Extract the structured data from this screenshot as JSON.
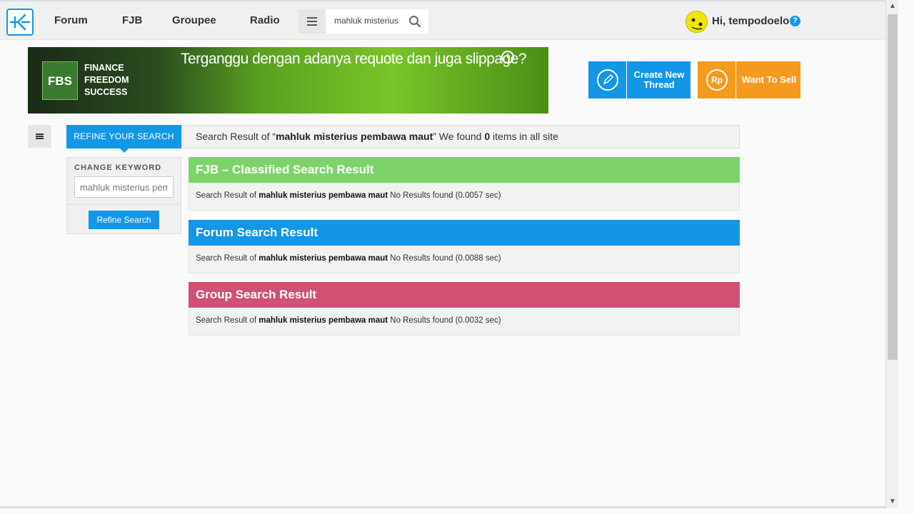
{
  "topbar": {
    "nav": [
      "Forum",
      "FJB",
      "Groupee",
      "Radio"
    ],
    "search_value": "mahluk misterius pembawa maut",
    "greeting": "Hi, tempodoelo",
    "help": "?"
  },
  "banner": {
    "brand_box": "FBS",
    "brand_lines": [
      "FINANCE",
      "FREEDOM",
      "SUCCESS"
    ],
    "slogan": "Terganggu dengan adanya requote dan juga slippage?"
  },
  "actions": {
    "create_label": "Create New Thread",
    "sell_label": "Want To Sell",
    "sell_icon": "Rp"
  },
  "refine": {
    "tab_label": "REFINE YOUR SEARCH",
    "change_keyword_label": "CHANGE KEYWORD",
    "keyword_placeholder": "mahluk misterius pembawa maut",
    "button_label": "Refine Search"
  },
  "summary": {
    "prefix": "Search Result of “",
    "query": "mahluk misterius pembawa maut",
    "middle": "” We found ",
    "count": "0",
    "suffix": " items in all site"
  },
  "results": [
    {
      "title": "FJB – Classified Search Result",
      "color": "#7dd36a",
      "prefix": "Search Result of ",
      "query": "mahluk misterius pembawa maut",
      "status": "  No Results found (0.0057 sec)"
    },
    {
      "title": "Forum Search Result",
      "color": "#1496e6",
      "prefix": "Search Result of ",
      "query": "mahluk misterius pembawa maut",
      "status": " No Results found (0.0088 sec)"
    },
    {
      "title": "Group Search Result",
      "color": "#d05173",
      "prefix": "Search Result of ",
      "query": "mahluk misterius pembawa maut",
      "status": " No Results found (0.0032 sec)"
    }
  ]
}
